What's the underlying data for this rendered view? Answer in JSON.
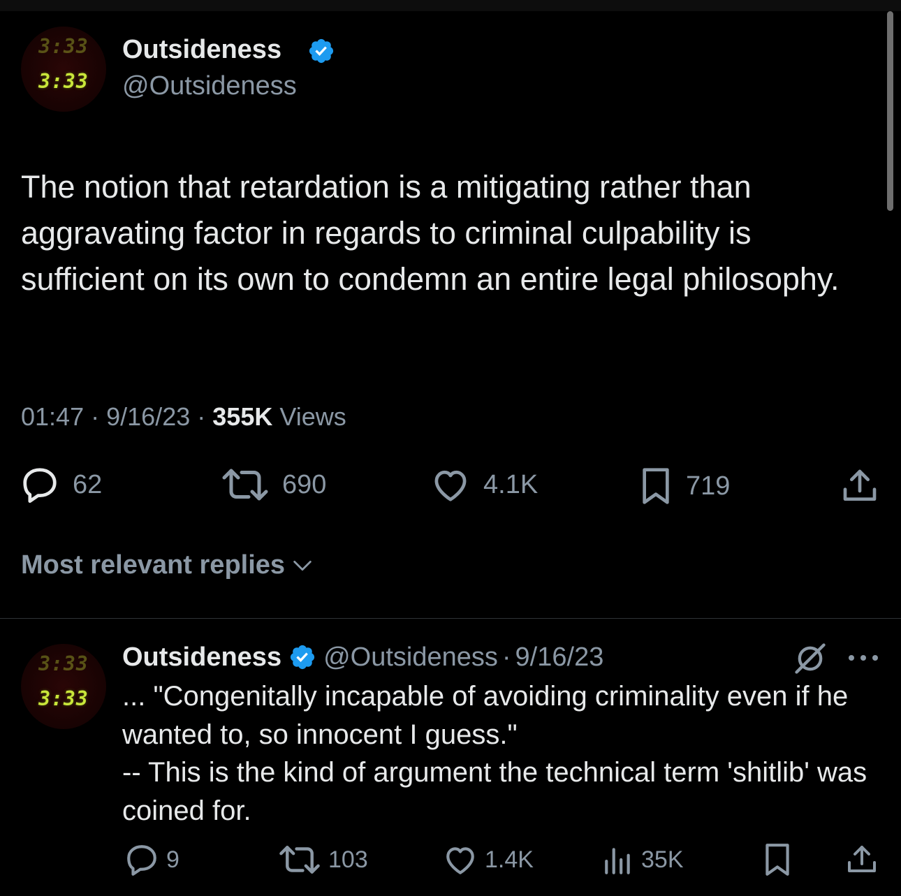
{
  "tweet": {
    "author_name": "Outsideness",
    "author_handle": "@Outsideness",
    "avatar_text": "3:33",
    "text": "The notion that retardation is a mitigating rather than aggravating factor in regards to criminal culpability is sufficient on its own to condemn an entire legal philosophy.",
    "time": "01:47",
    "sep1": "·",
    "date": "9/16/23",
    "sep2": "·",
    "views_count": "355K",
    "views_label": "Views",
    "replies": "62",
    "reposts": "690",
    "likes": "4.1K",
    "bookmarks": "719"
  },
  "sort_label": "Most relevant replies",
  "reply": {
    "author_name": "Outsideness",
    "author_handle": "@Outsideness",
    "sep": "·",
    "date": "9/16/23",
    "avatar_text": "3:33",
    "line1": "... \"Congenitally incapable of avoiding criminality even if he wanted to, so innocent I guess.\"",
    "line2": "-- This is the kind of argument the technical term 'shitlib' was coined for.",
    "replies": "9",
    "reposts": "103",
    "likes": "1.4K",
    "views": "35K"
  },
  "colors": {
    "background": "#000000",
    "text": "#e7e9ea",
    "muted": "#8b98a5",
    "verified": "#1d9bf0",
    "avatar_digits": "#c9e63a"
  },
  "icons": [
    "verified-badge-icon",
    "reply-icon",
    "repost-icon",
    "like-icon",
    "bookmark-icon",
    "share-icon",
    "chevron-down-icon",
    "grok-icon",
    "more-icon",
    "views-icon"
  ]
}
